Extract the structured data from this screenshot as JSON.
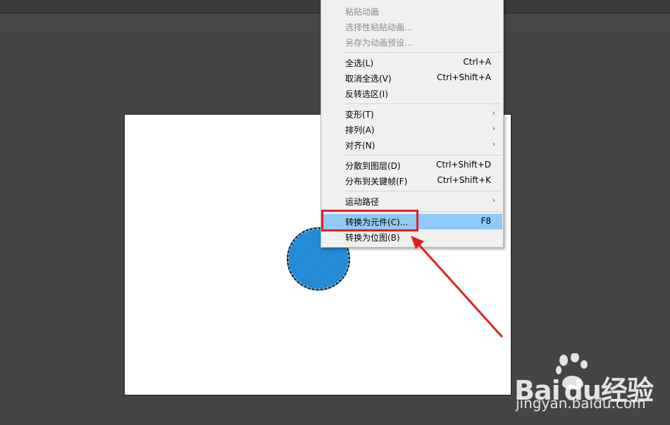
{
  "menu": {
    "items": [
      {
        "label": "粘贴动画",
        "shortcut": "",
        "disabled": true
      },
      {
        "label": "选择性粘贴动画...",
        "shortcut": "",
        "disabled": true
      },
      {
        "label": "另存为动画预设...",
        "shortcut": "",
        "disabled": true
      },
      {
        "label": "全选(L)",
        "shortcut": "Ctrl+A"
      },
      {
        "label": "取消全选(V)",
        "shortcut": "Ctrl+Shift+A"
      },
      {
        "label": "反转选区(I)",
        "shortcut": ""
      },
      {
        "label": "变形(T)",
        "submenu_glyph": "›"
      },
      {
        "label": "排列(A)",
        "submenu_glyph": "›"
      },
      {
        "label": "对齐(N)",
        "submenu_glyph": "›"
      },
      {
        "label": "分散到图层(D)",
        "shortcut": "Ctrl+Shift+D"
      },
      {
        "label": "分布到关键帧(F)",
        "shortcut": "Ctrl+Shift+K"
      },
      {
        "label": "运动路径",
        "submenu_glyph": "›"
      },
      {
        "label": "转换为元件(C)...",
        "shortcut": "F8",
        "highlighted": true
      },
      {
        "label": "转换为位图(B)",
        "shortcut": ""
      }
    ]
  },
  "watermark": {
    "brand_left": "Bai",
    "brand_mid": "du",
    "brand_right": "经验",
    "url": "jingyan.baidu.com"
  },
  "colors": {
    "highlight": "#91c9f7",
    "annotation_red": "#e02020",
    "shape_fill": "#2a90d8"
  }
}
